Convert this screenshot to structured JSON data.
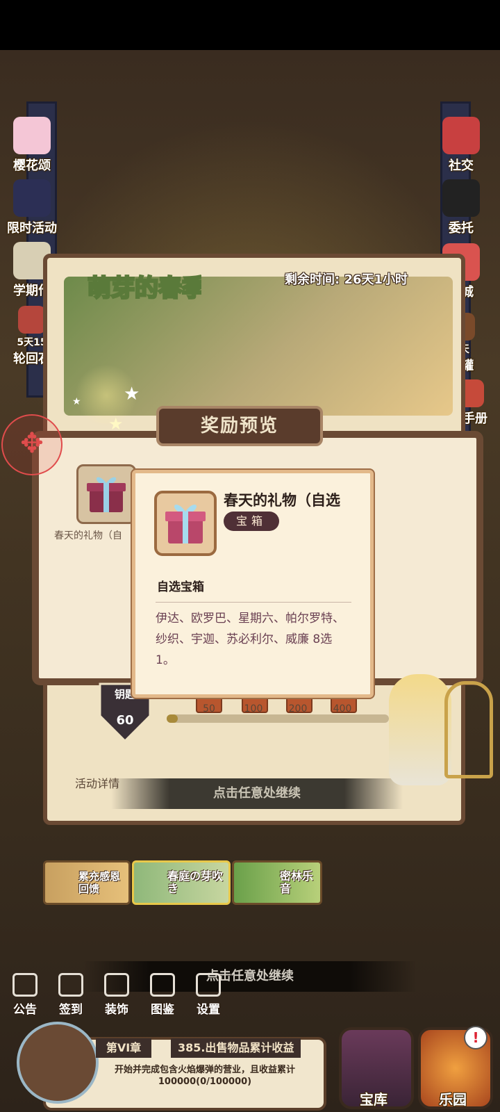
{
  "left_sidebar": [
    {
      "label": "樱花颂"
    },
    {
      "label": "限时活动"
    },
    {
      "label": "学期作"
    },
    {
      "label": "5天15",
      "sublabel": "轮回石"
    }
  ],
  "right_sidebar": [
    {
      "label": "社交"
    },
    {
      "label": "委托"
    },
    {
      "label": "商城"
    },
    {
      "label": "5天",
      "sublabel": "蓄罐"
    },
    {
      "label": "长手册"
    }
  ],
  "event": {
    "title_art": "萌芽的春季花园",
    "remaining_time": "剩余时间: 26天1小时",
    "reward_preview_title": "奖励预览",
    "reward_slot_label": "春天的礼物（自",
    "key_label": "钥匙",
    "key_count": "60",
    "progress_fraction": 0.05,
    "milestones": [
      "50",
      "100",
      "200",
      "400"
    ],
    "activity_details": "活动详情",
    "continue_text": "点击任意处继续"
  },
  "tooltip": {
    "item_name": "春天的礼物（自选",
    "tag": "宝箱",
    "subtitle": "自选宝箱",
    "description": "伊达、欧罗巴、星期六、帕尔罗特、纱织、宇迦、苏必利尔、威廉 8选1。"
  },
  "event_tabs": [
    {
      "label": "累充感恩回馈"
    },
    {
      "label": "春庭の芽吹き"
    },
    {
      "label": "密林乐音"
    }
  ],
  "continue_text_2": "点击任意处继续",
  "bottom_nav": [
    {
      "label": "公告",
      "icon": "notice-board-icon"
    },
    {
      "label": "签到",
      "icon": "calendar-icon"
    },
    {
      "label": "装饰",
      "icon": "decoration-icon"
    },
    {
      "label": "图鉴",
      "icon": "encyclopedia-icon"
    },
    {
      "label": "设置",
      "icon": "settings-icon"
    }
  ],
  "chapter": {
    "tag": "第VI章",
    "task_title": "385.出售物品累计收益",
    "description": "开始并完成包含火焰爆弹的营业，且收益累计100000(0/100000)"
  },
  "right_buttons": [
    {
      "label": "宝库"
    },
    {
      "label": "乐园"
    }
  ],
  "alert_badge": "!",
  "colors": {
    "panel_border": "#6a4a34",
    "tooltip_bg": "#fbf1dc",
    "tag_bg": "#4f3036",
    "gamepad_red": "#e04c4c"
  }
}
